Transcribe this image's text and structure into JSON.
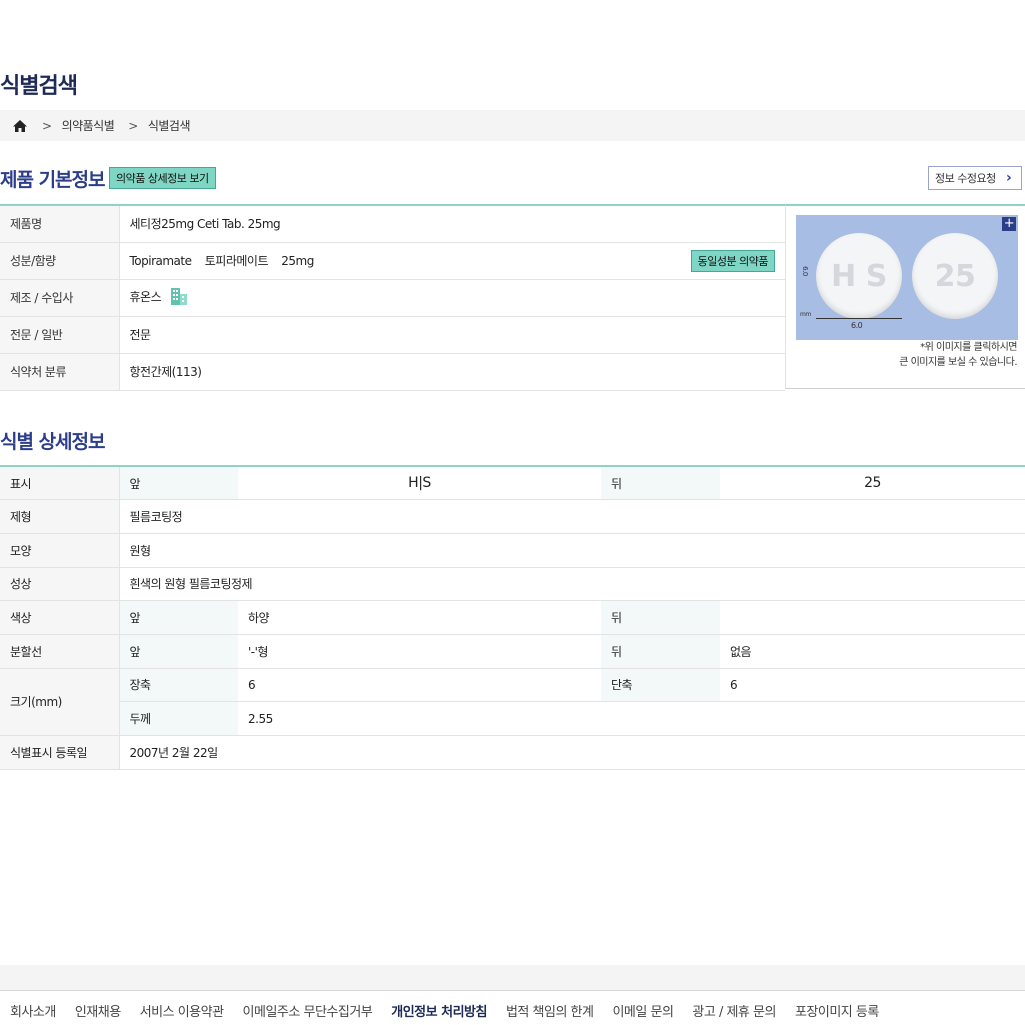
{
  "page_title": "식별검색",
  "breadcrumb": {
    "home_icon": "home-icon",
    "items": [
      "의약품식별",
      "식별검색"
    ]
  },
  "basic": {
    "title": "제품 기본정보",
    "detail_button": "의약품 상세정보 보기",
    "edit_button": "정보 수정요청",
    "same_ingredient_button": "동일성분 의약품",
    "rows": [
      {
        "label": "제품명",
        "value": "세티정25mg Ceti Tab. 25mg"
      },
      {
        "label": "성분/함량",
        "value": "Topiramate    토피라메이트    25mg"
      },
      {
        "label": "제조 / 수입사",
        "value": "휴온스"
      },
      {
        "label": "전문 / 일반",
        "value": "전문"
      },
      {
        "label": "식약처 분류",
        "value": "항전간제(113)"
      }
    ],
    "image_note": [
      "*위 이미지를 클릭하시면",
      "큰 이미지를 보실 수 있습니다."
    ],
    "pill_front_text": "H S",
    "pill_back_text": "25",
    "pill_dim_width": "6.0",
    "pill_dim_height": "6.0",
    "pill_mm": "mm"
  },
  "detail": {
    "title": "식별 상세정보",
    "front": "앞",
    "back": "뒤",
    "rows": {
      "marking": {
        "label": "표시",
        "front": "H|S",
        "back": "25"
      },
      "form": {
        "label": "제형",
        "value": "필름코팅정"
      },
      "shape": {
        "label": "모양",
        "value": "원형"
      },
      "appearance": {
        "label": "성상",
        "value": "흰색의 원형 필름코팅정제"
      },
      "color": {
        "label": "색상",
        "front": "하양",
        "back": ""
      },
      "score": {
        "label": "분할선",
        "front": "'-'형",
        "back": "없음"
      },
      "size": {
        "label": "크기(mm)",
        "long_label": "장축",
        "long": "6",
        "short_label": "단축",
        "short": "6",
        "thick_label": "두께",
        "thick": "2.55"
      },
      "date": {
        "label": "식별표시 등록일",
        "value": "2007년 2월 22일"
      }
    }
  },
  "footer": [
    "회사소개",
    "인재채용",
    "서비스 이용약관",
    "이메일주소 무단수집거부",
    "개인정보 처리방침",
    "법적 책임의 한계",
    "이메일 문의",
    "광고 / 제휴 문의",
    "포장이미지 등록"
  ],
  "colors": {
    "accent": "#2c3e8a",
    "green_button": "#7fd6c4",
    "table_border": "#8fd3c8"
  }
}
